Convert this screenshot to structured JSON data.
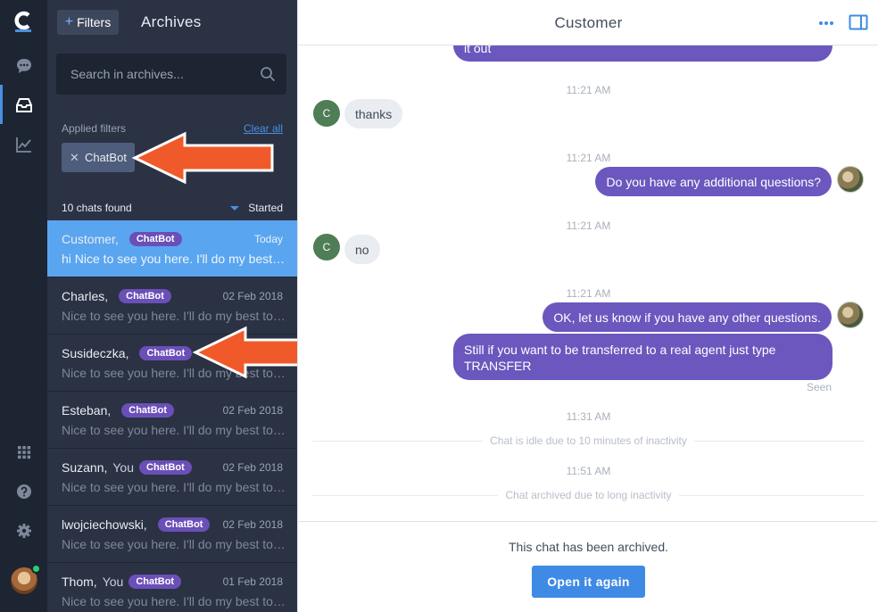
{
  "rail": {
    "icons": [
      "logo-icon",
      "chats-icon",
      "archives-icon",
      "reports-icon",
      "apps-grid-icon",
      "help-icon",
      "settings-icon"
    ]
  },
  "panel": {
    "filters_label": "Filters",
    "title": "Archives",
    "search_placeholder": "Search in archives...",
    "applied_filters_label": "Applied filters",
    "clear_all": "Clear all",
    "filter_chip": "ChatBot",
    "found": "10 chats found",
    "sort_label": "Started"
  },
  "chats": [
    {
      "name": "Customer,",
      "you": "",
      "badge": "ChatBot",
      "date": "Today",
      "preview": "hi Nice to see you here. I'll do my best to help you",
      "active": true
    },
    {
      "name": "Charles,",
      "you": "",
      "badge": "ChatBot",
      "date": "02 Feb 2018",
      "preview": "Nice to see you here. I'll do my best to help you",
      "active": false
    },
    {
      "name": "Susideczka,",
      "you": "",
      "badge": "ChatBot",
      "date": "",
      "preview": "Nice to see you here. I'll do my best to help you",
      "active": false
    },
    {
      "name": "Esteban,",
      "you": "",
      "badge": "ChatBot",
      "date": "02 Feb 2018",
      "preview": "Nice to see you here. I'll do my best to help you",
      "active": false
    },
    {
      "name": "Suzann,",
      "you": "You",
      "badge": "ChatBot",
      "date": "02 Feb 2018",
      "preview": "Nice to see you here. I'll do my best to help you",
      "active": false
    },
    {
      "name": "lwojciechowski,",
      "you": "",
      "badge": "ChatBot",
      "date": "02 Feb 2018",
      "preview": "Nice to see you here. I'll do my best to help you",
      "active": false
    },
    {
      "name": "Thom,",
      "you": "You",
      "badge": "ChatBot",
      "date": "01 Feb 2018",
      "preview": "Nice to see you here. I'll do my best to help you",
      "active": false
    }
  ],
  "chat": {
    "title": "Customer",
    "cut_message": "it out",
    "ts1": "11:21 AM",
    "avatar_initial": "C",
    "msg_thanks": "thanks",
    "ts2": "11:21 AM",
    "msg_questions": "Do you have any additional questions?",
    "ts3": "11:21 AM",
    "msg_no": "no",
    "ts4": "11:21 AM",
    "msg_ok": "OK, let us know if you have any other questions.",
    "msg_transfer": "Still if you want to be transferred to a real agent just type TRANSFER",
    "seen": "Seen",
    "ts5": "11:31 AM",
    "idle": "Chat is idle due to 10 minutes of inactivity",
    "ts6": "11:51 AM",
    "archived_sys": "Chat archived due to long inactivity"
  },
  "footer": {
    "archived_text": "This chat has been archived.",
    "reopen_label": "Open it again"
  },
  "colors": {
    "rail_bg": "#1d2432",
    "panel_bg": "#2a3244",
    "active_row": "#5aa5ef",
    "badge": "#6b4fb8",
    "outgoing_bubble": "#6b57be",
    "button": "#3f8ae4",
    "arrow": "#f05a2a"
  }
}
